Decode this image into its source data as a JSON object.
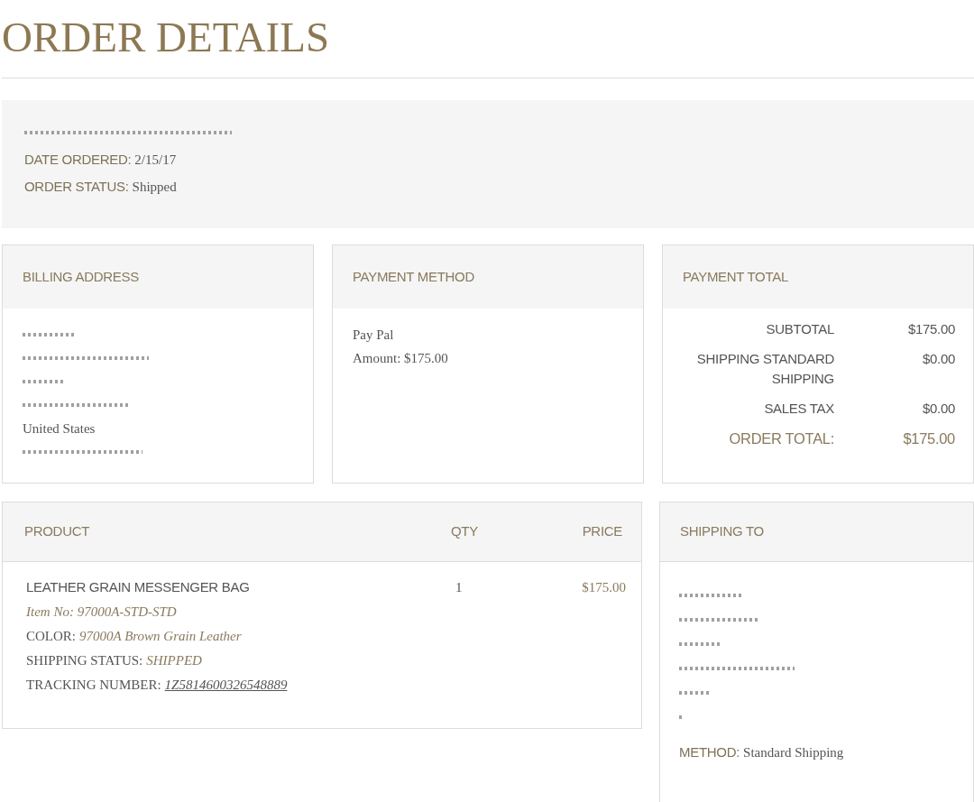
{
  "page": {
    "title": "ORDER DETAILS"
  },
  "summary": {
    "lines": [
      {
        "kind": "redacted"
      },
      {
        "kind": "field",
        "label": "DATE ORDERED:",
        "value": "2/15/17"
      },
      {
        "kind": "field",
        "label": "ORDER STATUS:",
        "value": "Shipped"
      }
    ]
  },
  "billing_address": {
    "heading": "BILLING ADDRESS",
    "lines": [
      {
        "kind": "redacted"
      },
      {
        "kind": "redacted"
      },
      {
        "kind": "redacted"
      },
      {
        "kind": "redacted"
      },
      {
        "kind": "text",
        "text": "United States"
      },
      {
        "kind": "redacted"
      }
    ]
  },
  "payment_method": {
    "heading": "PAYMENT METHOD",
    "lines": [
      "Pay Pal",
      "Amount: $175.00"
    ]
  },
  "payment_total": {
    "heading": "PAYMENT TOTAL",
    "rows": [
      {
        "kind": "line",
        "label": "SUBTOTAL",
        "value": "$175.00"
      },
      {
        "kind": "line",
        "label": "SHIPPING STANDARD SHIPPING",
        "value": "$0.00"
      },
      {
        "kind": "line",
        "label": "SALES TAX",
        "value": "$0.00"
      },
      {
        "kind": "total",
        "label": "ORDER TOTAL:",
        "value": "$175.00"
      }
    ]
  },
  "products": {
    "columns": [
      "PRODUCT",
      "QTY",
      "PRICE"
    ],
    "rows": [
      {
        "name": "LEATHER GRAIN MESSENGER BAG",
        "item_no": "Item No: 97000A-STD-STD",
        "details": [
          {
            "kind": "text",
            "label": "COLOR:",
            "value": "97000A Brown Grain Leather"
          },
          {
            "kind": "text",
            "label": "SHIPPING STATUS:",
            "value": "SHIPPED"
          },
          {
            "kind": "link",
            "label": "TRACKING NUMBER:",
            "value": "1Z5814600326548889"
          }
        ],
        "qty": "1",
        "price": "$175.00"
      }
    ]
  },
  "shipping_to": {
    "heading": "SHIPPING TO",
    "lines": [
      {
        "kind": "redacted"
      },
      {
        "kind": "redacted"
      },
      {
        "kind": "redacted"
      },
      {
        "kind": "redacted"
      },
      {
        "kind": "redacted"
      },
      {
        "kind": "redacted"
      }
    ],
    "method": {
      "label": "METHOD:",
      "value": "Standard Shipping"
    }
  }
}
